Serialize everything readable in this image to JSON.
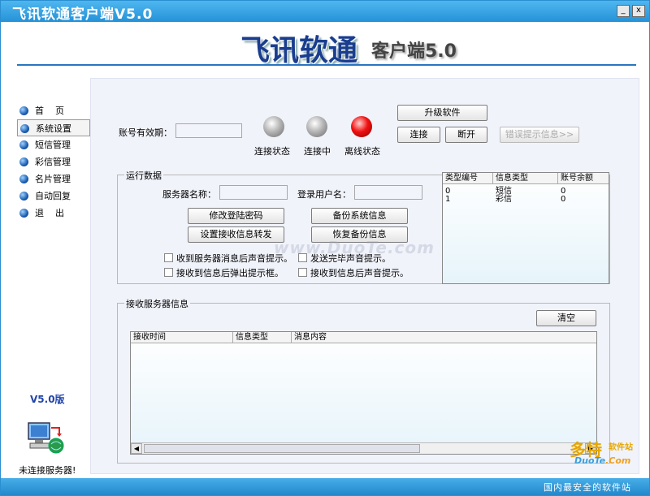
{
  "window": {
    "title": "飞讯软通客户端V5.0",
    "min_label": "_",
    "close_label": "x"
  },
  "logo": {
    "main": "飞讯软通",
    "sub": "客户端5.0"
  },
  "sidebar": {
    "items": [
      {
        "label": "首    页"
      },
      {
        "label": "系统设置"
      },
      {
        "label": "短信管理"
      },
      {
        "label": "彩信管理"
      },
      {
        "label": "名片管理"
      },
      {
        "label": "自动回复"
      },
      {
        "label": "退    出"
      }
    ],
    "active_index": 1,
    "version": "V5.0版",
    "status": "未连接服务器!"
  },
  "top": {
    "validity_label": "账号有效期：",
    "validity_value": "",
    "leds": [
      {
        "label": "连接状态",
        "color": "gray"
      },
      {
        "label": "连接中",
        "color": "gray"
      },
      {
        "label": "离线状态",
        "color": "red"
      }
    ],
    "upgrade_label": "升级软件",
    "connect_label": "连接",
    "disconnect_label": "断开",
    "error_label": "错误提示信息>>"
  },
  "run": {
    "title": "运行数据",
    "server_label": "服务器名称：",
    "server_value": "",
    "user_label": "登录用户名：",
    "user_value": "",
    "buttons": [
      "修改登陆密码",
      "备份系统信息",
      "设置接收信息转发",
      "恢复备份信息"
    ],
    "checkboxes": [
      "收到服务器消息后声音提示。",
      "发送完毕声音提示。",
      "接收到信息后弹出提示框。",
      "接收到信息后声音提示。"
    ],
    "grid": {
      "columns": [
        "类型编号",
        "信息类型",
        "账号余额"
      ],
      "rows": [
        [
          "0",
          "短信",
          "0"
        ],
        [
          "1",
          "彩信",
          "0"
        ]
      ]
    }
  },
  "recv": {
    "title": "接收服务器信息",
    "clear_label": "清空",
    "columns": [
      "接收时间",
      "信息类型",
      "消息内容"
    ]
  },
  "watermark": "www.DuoTe.com",
  "brand": {
    "name": "多特",
    "sub": "软件站",
    "url_a": "DuoTe",
    "url_b": ".Com",
    "footer": "国内最安全的软件站"
  }
}
